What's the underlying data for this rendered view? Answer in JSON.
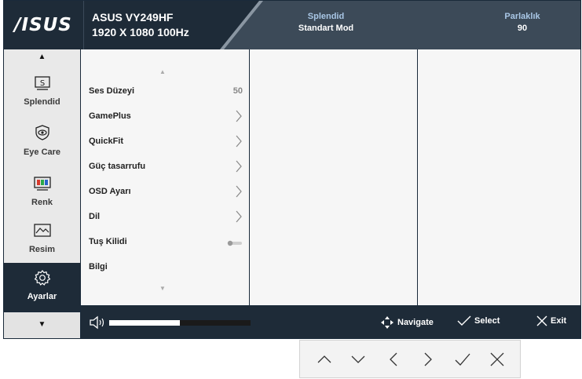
{
  "header": {
    "logo": "/ISUS",
    "model": "ASUS VY249HF",
    "resolution": "1920 X 1080 100Hz",
    "info": [
      {
        "key": "Splendid",
        "value": "Standart Mod"
      },
      {
        "key": "Parlaklık",
        "value": "90"
      }
    ]
  },
  "sidebar": {
    "items": [
      {
        "label": "Splendid",
        "icon": "splendid-icon"
      },
      {
        "label": "Eye Care",
        "icon": "eye-care-icon"
      },
      {
        "label": "Renk",
        "icon": "color-icon"
      },
      {
        "label": "Resim",
        "icon": "image-icon"
      },
      {
        "label": "Ayarlar",
        "icon": "settings-icon",
        "active": true
      }
    ]
  },
  "menu": {
    "items": [
      {
        "label": "Ses Düzeyi",
        "value": "50"
      },
      {
        "label": "GamePlus"
      },
      {
        "label": "QuickFit"
      },
      {
        "label": "Güç tasarrufu"
      },
      {
        "label": "OSD Ayarı"
      },
      {
        "label": "Dil"
      },
      {
        "label": "Tuş Kilidi",
        "toggle": "off"
      },
      {
        "label": "Bilgi"
      }
    ]
  },
  "volume": {
    "level_fraction": 0.5
  },
  "bottom_bar": {
    "navigate": "Navigate",
    "select": "Select",
    "exit": "Exit"
  },
  "colors": {
    "dark": "#1e2b38",
    "accent_text": "#a9c7e6",
    "panel": "#f6f6f6"
  },
  "keys": [
    "up-chevron-icon",
    "down-chevron-icon",
    "left-chevron-icon",
    "right-chevron-icon",
    "check-icon",
    "close-icon"
  ]
}
